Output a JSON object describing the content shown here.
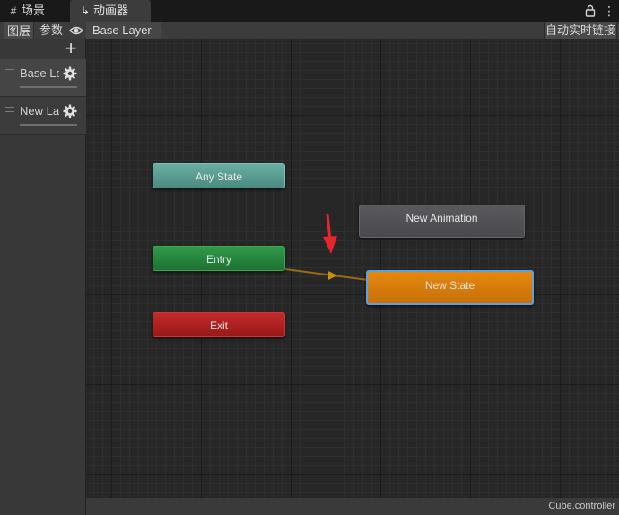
{
  "tabs": {
    "scene": {
      "icon": "grid-icon",
      "label": "场景"
    },
    "animator": {
      "icon": "graph-icon",
      "label": "动画器"
    }
  },
  "toolbar": {
    "layers_label": "图层",
    "params_label": "参数",
    "breadcrumb": "Base Layer",
    "live_link_label": "自动实时链接"
  },
  "layers": {
    "items": [
      {
        "name": "Base La"
      },
      {
        "name": "New La"
      }
    ]
  },
  "graph": {
    "nodes": {
      "any_state": "Any State",
      "entry": "Entry",
      "exit": "Exit",
      "new_animation": "New Animation",
      "new_state": "New State"
    },
    "colors": {
      "any_state": "#5a9d92",
      "entry": "#27863f",
      "exit": "#b02020",
      "new_animation": "#525256",
      "new_state": "#d67c0c",
      "selection": "#5aa2e6",
      "annotation_arrow": "#e8242c"
    }
  },
  "status": {
    "file": "Cube.controller"
  }
}
